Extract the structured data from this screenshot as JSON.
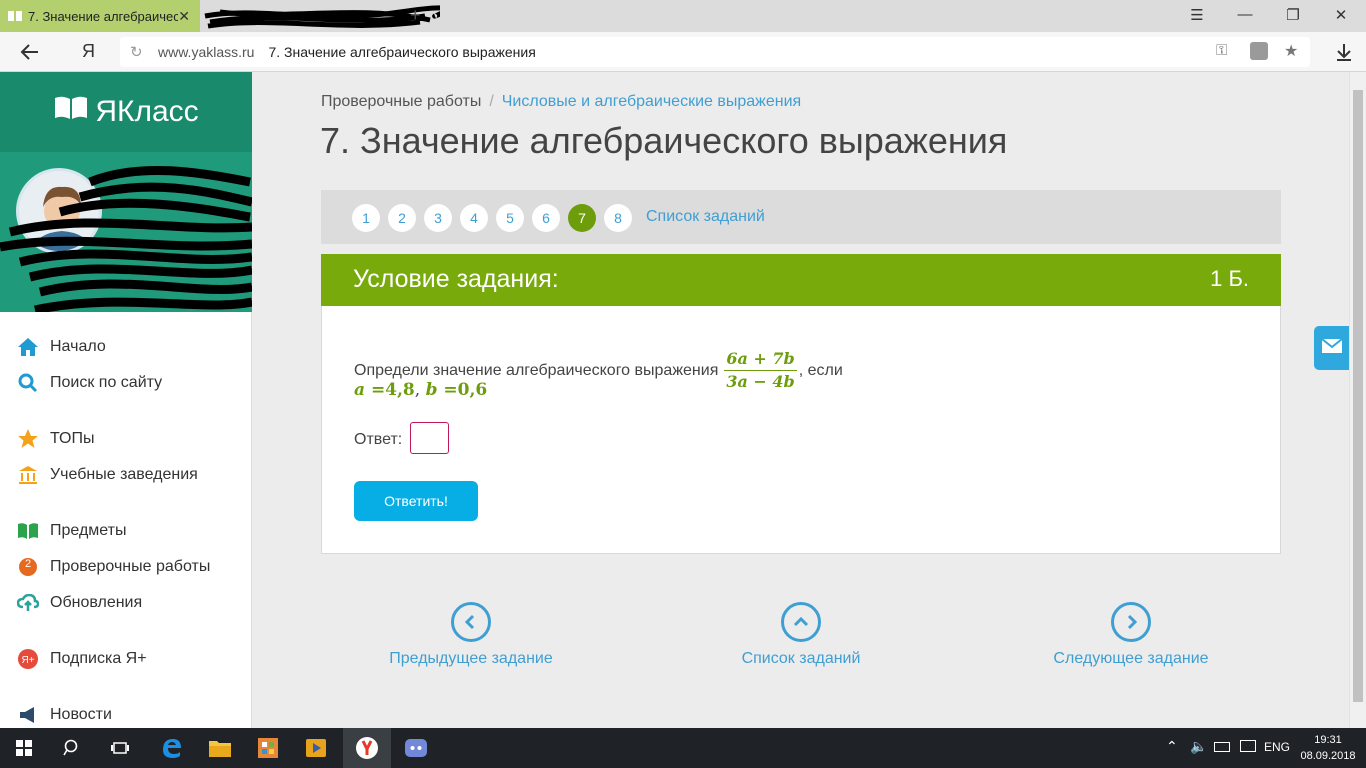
{
  "browser": {
    "tab_title": "7. Значение алгебраичес",
    "tab_close": "✕",
    "new_tab": "+",
    "address_domain": "www.yaklass.ru",
    "address_title": "7. Значение алгебраического выражения",
    "browser_logo": "Я"
  },
  "sidebar": {
    "logo_text": "ЯКласс",
    "items": [
      {
        "label": "Начало",
        "icon": "home-icon",
        "color": "#1f9ad3"
      },
      {
        "label": "Поиск по сайту",
        "icon": "search-icon",
        "color": "#1f9ad3"
      },
      {
        "label": "ТОПы",
        "icon": "star-icon",
        "color": "#f4a21a"
      },
      {
        "label": "Учебные заведения",
        "icon": "institution-icon",
        "color": "#f4a21a"
      },
      {
        "label": "Предметы",
        "icon": "book-icon",
        "color": "#2aa34a"
      },
      {
        "label": "Проверочные работы",
        "icon": "test-icon",
        "color": "#e56a1f",
        "badge": "2"
      },
      {
        "label": "Обновления",
        "icon": "cloud-icon",
        "color": "#2aa39a"
      },
      {
        "label": "Подписка Я+",
        "icon": "subscription-icon",
        "color": "#e54a3a"
      },
      {
        "label": "Новости",
        "icon": "news-icon",
        "color": "#2c4a6a"
      }
    ]
  },
  "breadcrumb": {
    "root": "Проверочные работы",
    "separator": "/",
    "current": "Числовые и алгебраические выражения"
  },
  "page_title": "7. Значение алгебраического выражения",
  "pager": {
    "numbers": [
      "1",
      "2",
      "3",
      "4",
      "5",
      "6",
      "7",
      "8"
    ],
    "active": "7",
    "task_list": "Список заданий"
  },
  "condition": {
    "title": "Условие задания:",
    "points": "1 Б.",
    "question_text": "Определи значение алгебраического выражения",
    "numerator": "6a + 7b",
    "denominator": "3a − 4b",
    "suffix": ", если",
    "var_a": "a",
    "val_a": "=4,8",
    "var_b": "b",
    "val_b": "=0,6",
    "answer_label": "Ответ:",
    "answer_value": "",
    "submit_label": "Ответить!"
  },
  "navigation": {
    "prev": "Предыдущее задание",
    "list": "Список заданий",
    "next": "Следующее задание"
  },
  "taskbar": {
    "lang": "ENG",
    "time": "19:31",
    "date": "08.09.2018"
  },
  "colors": {
    "green_header": "#77aa0a",
    "link_blue": "#3f9fd3",
    "submit_blue": "#07aee5",
    "sidebar_green": "#1a8a6c"
  }
}
